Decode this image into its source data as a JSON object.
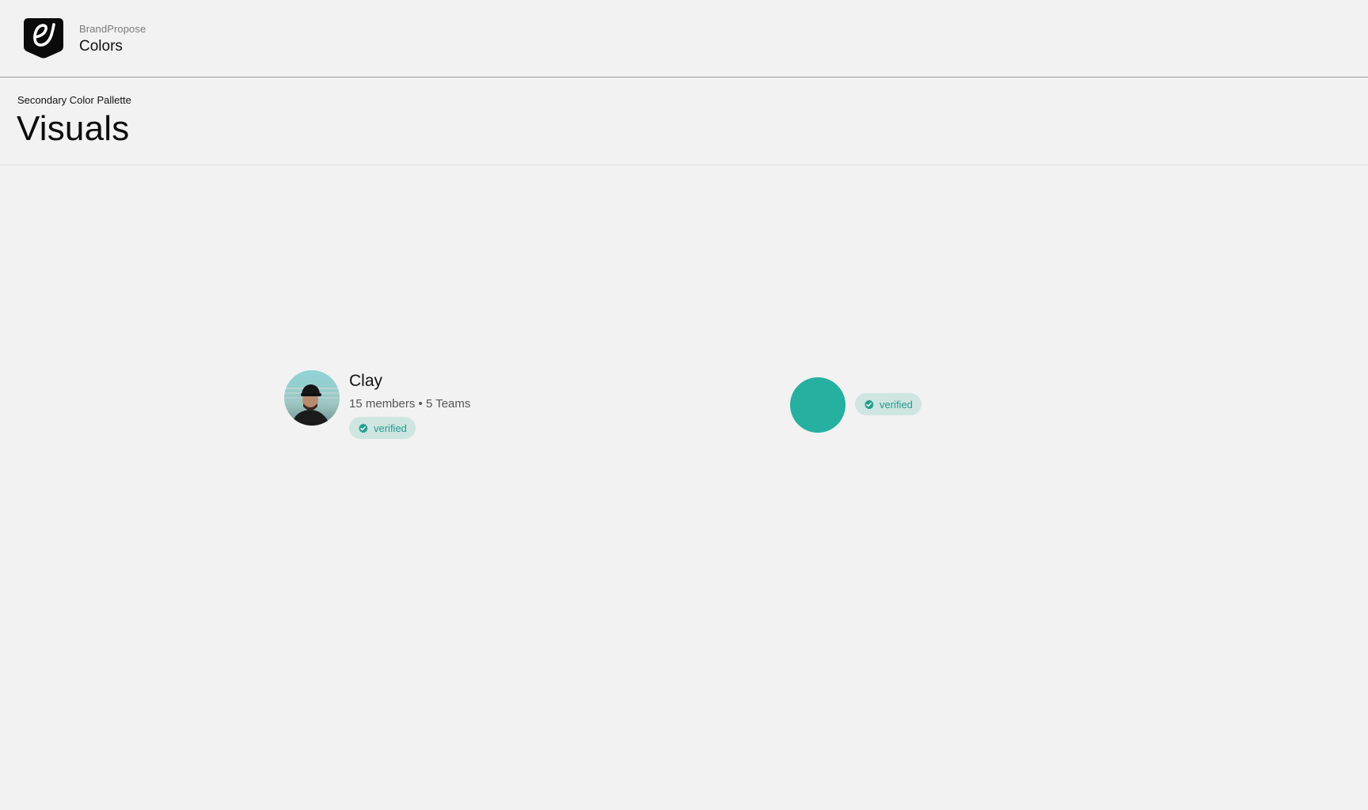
{
  "header": {
    "brand_name": "BrandPropose",
    "section": "Colors",
    "logo_icon": "brandpropose-logo-icon"
  },
  "page": {
    "eyebrow": "Secondary Color Pallette",
    "title": "Visuals"
  },
  "profile_card": {
    "name": "Clay",
    "meta": "15 members • 5 Teams",
    "badge_label": "verified",
    "badge_icon": "verified-check-icon",
    "avatar_icon": "profile-photo"
  },
  "swatch_card": {
    "badge_label": "verified",
    "badge_icon": "verified-check-icon"
  },
  "colors": {
    "accent": "#26b0a0",
    "badge_bg": "#cfe5e2",
    "badge_text": "#1f9d8c",
    "background": "#f2f2f2"
  }
}
